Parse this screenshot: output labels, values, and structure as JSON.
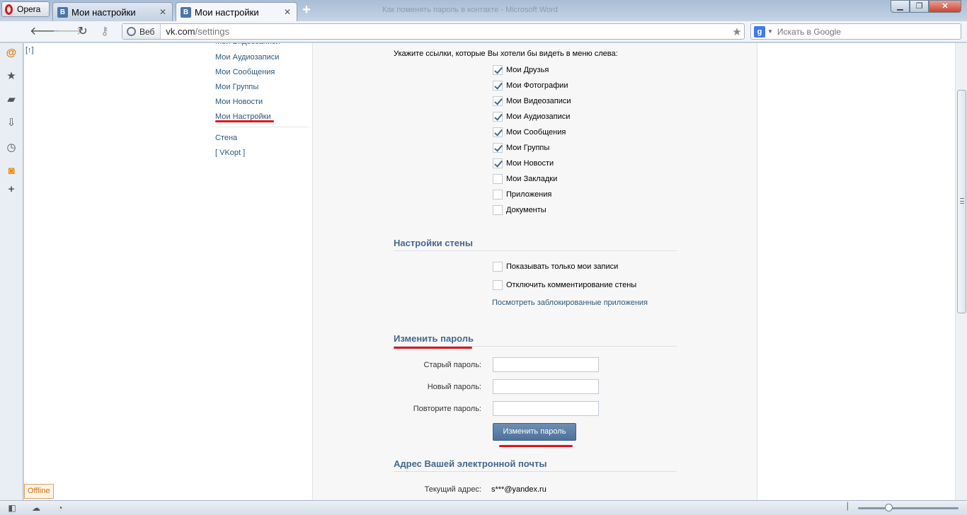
{
  "browser": {
    "opera_label": "Opera",
    "tabs": [
      {
        "title": "Мои настройки",
        "favicon": "В"
      },
      {
        "title": "Мои настройки",
        "favicon": "В"
      }
    ],
    "window_title": "Как поменять пароль в контакте - Microsoft Word",
    "address": {
      "web_label": "Веб",
      "host": "vk.com",
      "path": "/settings"
    },
    "search": {
      "placeholder": "Искать в Google",
      "engine_icon": "g"
    }
  },
  "page": {
    "to_top": "[↑]",
    "left_menu": {
      "cut_item": "Мои Видеозаписи",
      "items": [
        "Мои Аудиозаписи",
        "Мои Сообщения",
        "Мои Группы",
        "Мои Новости",
        "Мои Настройки"
      ],
      "extra": [
        "Стена",
        "[ VKopt ]"
      ]
    },
    "menu_settings": {
      "intro": "Укажите ссылки, которые Вы хотели бы видеть в меню слева:",
      "options": [
        {
          "label": "Мои Друзья",
          "checked": true
        },
        {
          "label": "Мои Фотографии",
          "checked": true
        },
        {
          "label": "Мои Видеозаписи",
          "checked": true
        },
        {
          "label": "Мои Аудиозаписи",
          "checked": true
        },
        {
          "label": "Мои Сообщения",
          "checked": true
        },
        {
          "label": "Мои Группы",
          "checked": true
        },
        {
          "label": "Мои Новости",
          "checked": true
        },
        {
          "label": "Мои Закладки",
          "checked": false
        },
        {
          "label": "Приложения",
          "checked": false
        },
        {
          "label": "Документы",
          "checked": false
        }
      ]
    },
    "wall": {
      "heading": "Настройки стены",
      "options": [
        {
          "label": "Показывать только мои записи",
          "checked": false
        },
        {
          "label": "Отключить комментирование стены",
          "checked": false
        }
      ],
      "blocked_apps_link": "Посмотреть заблокированные приложения"
    },
    "password": {
      "heading": "Изменить пароль",
      "old_label": "Старый пароль:",
      "new_label": "Новый пароль:",
      "repeat_label": "Повторите пароль:",
      "old_value": "",
      "new_value": "",
      "repeat_value": "",
      "submit": "Изменить пароль"
    },
    "email": {
      "heading": "Адрес Вашей электронной почты",
      "current_label": "Текущий адрес:",
      "current_value": "s***@yandex.ru"
    }
  },
  "status": {
    "offline": "Offline",
    "zoom_level_fraction": 0.3
  },
  "colors": {
    "vk_link": "#2b587a",
    "vk_heading": "#45688e",
    "annotation_red": "#e3131b"
  }
}
